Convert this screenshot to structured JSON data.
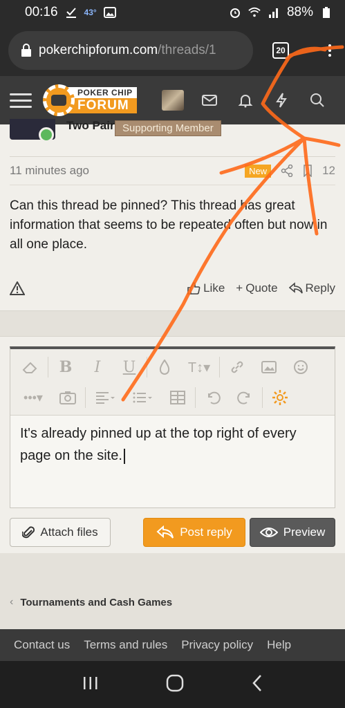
{
  "status_bar": {
    "time": "00:16",
    "temperature": "43°",
    "battery": "88%"
  },
  "browser": {
    "url_host": "pokerchipforum.com",
    "url_path": "/threads/1",
    "tab_count": "20"
  },
  "header": {
    "logo_top": "POKER CHIP",
    "logo_bottom": "FORUM"
  },
  "post": {
    "author": "Two Pair",
    "badge": "Supporting Member",
    "time": "11 minutes ago",
    "new_label": "New",
    "number": "12",
    "body": "Can this thread be pinned? This thread has great information that seems to be repeated often but now in all one place.",
    "actions": {
      "like": "Like",
      "quote": "Quote",
      "reply": "Reply"
    }
  },
  "editor": {
    "text": "It's already pinned up at the top right of every page on the site.",
    "attach_label": "Attach files",
    "post_label": "Post reply",
    "preview_label": "Preview"
  },
  "breadcrumb": {
    "label": "Tournaments and Cash Games"
  },
  "footer": {
    "links": [
      "Contact us",
      "Terms and rules",
      "Privacy policy",
      "Help"
    ]
  },
  "colors": {
    "accent": "#f29a1f",
    "annotation": "#ff6a1a",
    "header_bg": "#3a3a3a"
  }
}
